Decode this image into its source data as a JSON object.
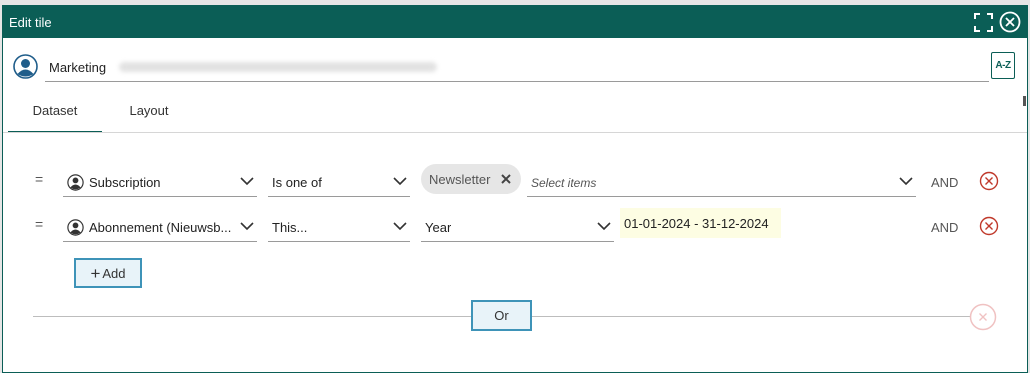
{
  "dialog": {
    "title": "Edit tile"
  },
  "name_field": {
    "value": "Marketing",
    "sort_button_label": "A-Z"
  },
  "tabs": [
    {
      "label": "Dataset",
      "active": true
    },
    {
      "label": "Layout",
      "active": false
    }
  ],
  "filters": [
    {
      "field": "Subscription",
      "operator": "Is one of",
      "chips": [
        "Newsletter"
      ],
      "select_placeholder": "Select items",
      "connector": "AND"
    },
    {
      "field": "Abonnement (Nieuwsb...",
      "operator": "This...",
      "period": "Year",
      "date_range": "01-01-2024 - 31-12-2024",
      "connector": "AND"
    }
  ],
  "add_button_label": "Add",
  "or_button_label": "Or",
  "colors": {
    "header": "#0b5e56",
    "accent_button": "#3e93b8",
    "remove": "#c0392b"
  }
}
